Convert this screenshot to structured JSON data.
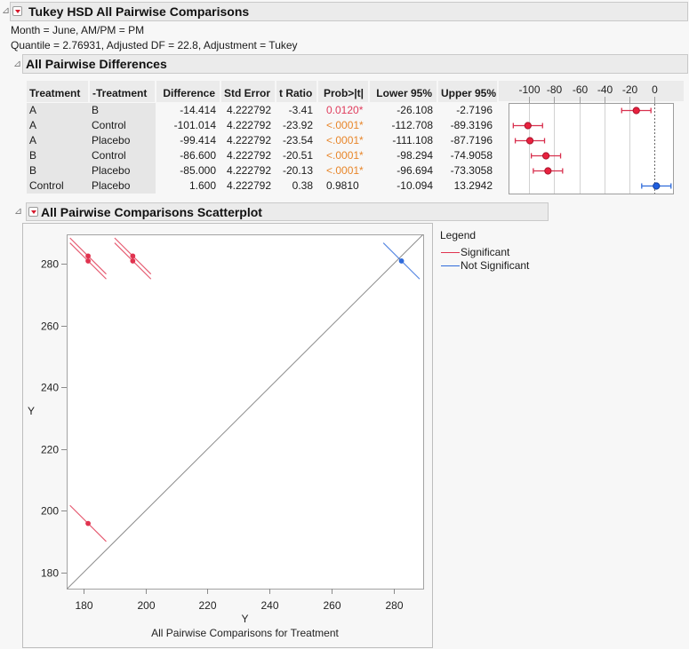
{
  "report": {
    "title": "Tukey HSD All Pairwise Comparisons",
    "info_lines": [
      "Month = June, AM/PM = PM",
      "Quantile = 2.76931, Adjusted DF = 22.8, Adjustment = Tukey"
    ]
  },
  "differences": {
    "title": "All Pairwise Differences",
    "columns": [
      "Treatment",
      "-Treatment",
      "Difference",
      "Std Error",
      "t Ratio",
      "Prob>|t|",
      "Lower 95%",
      "Upper 95%"
    ],
    "prob_colors": {
      "highly_significant": "#e8862a",
      "significant": "#e03c5c",
      "none": "#1a1a1a"
    },
    "rows": [
      {
        "treatment": "A",
        "minus_treatment": "B",
        "difference": "-14.414",
        "std_error": "4.222792",
        "t_ratio": "-3.41",
        "prob": "0.0120*",
        "prob_level": "significant",
        "lower": "-26.108",
        "upper": "-2.7196"
      },
      {
        "treatment": "A",
        "minus_treatment": "Control",
        "difference": "-101.014",
        "std_error": "4.222792",
        "t_ratio": "-23.92",
        "prob": "<.0001*",
        "prob_level": "highly_significant",
        "lower": "-112.708",
        "upper": "-89.3196"
      },
      {
        "treatment": "A",
        "minus_treatment": "Placebo",
        "difference": "-99.414",
        "std_error": "4.222792",
        "t_ratio": "-23.54",
        "prob": "<.0001*",
        "prob_level": "highly_significant",
        "lower": "-111.108",
        "upper": "-87.7196"
      },
      {
        "treatment": "B",
        "minus_treatment": "Control",
        "difference": "-86.600",
        "std_error": "4.222792",
        "t_ratio": "-20.51",
        "prob": "<.0001*",
        "prob_level": "highly_significant",
        "lower": "-98.294",
        "upper": "-74.9058"
      },
      {
        "treatment": "B",
        "minus_treatment": "Placebo",
        "difference": "-85.000",
        "std_error": "4.222792",
        "t_ratio": "-20.13",
        "prob": "<.0001*",
        "prob_level": "highly_significant",
        "lower": "-96.694",
        "upper": "-73.3058"
      },
      {
        "treatment": "Control",
        "minus_treatment": "Placebo",
        "difference": "1.600",
        "std_error": "4.222792",
        "t_ratio": "0.38",
        "prob": "0.9810",
        "prob_level": "none",
        "lower": "-10.094",
        "upper": "13.2942"
      }
    ]
  },
  "scatterplot": {
    "title": "All Pairwise Comparisons Scatterplot"
  },
  "chart_data": [
    {
      "type": "scatter",
      "title": "All Pairwise Differences (interval plot)",
      "x_ticks": [
        -100,
        -80,
        -60,
        -40,
        -20,
        0
      ],
      "xlim": [
        -116.5,
        14.9
      ],
      "reference_line": 0,
      "grid": true,
      "colors": {
        "significant": {
          "fill": "#e8213e",
          "stroke": "#a8142c",
          "bar": "#d8304e"
        },
        "not_significant": {
          "fill": "#1f5fe0",
          "stroke": "#143f9c",
          "bar": "#2f6bdb"
        }
      },
      "series": [
        {
          "name": "A - B",
          "estimate": -14.414,
          "lower": -26.108,
          "upper": -2.7196,
          "significant": true
        },
        {
          "name": "A - Control",
          "estimate": -101.014,
          "lower": -112.708,
          "upper": -89.3196,
          "significant": true
        },
        {
          "name": "A - Placebo",
          "estimate": -99.414,
          "lower": -111.108,
          "upper": -87.7196,
          "significant": true
        },
        {
          "name": "B - Control",
          "estimate": -86.6,
          "lower": -98.294,
          "upper": -74.9058,
          "significant": true
        },
        {
          "name": "B - Placebo",
          "estimate": -85.0,
          "lower": -96.694,
          "upper": -73.3058,
          "significant": true
        },
        {
          "name": "Control - Placebo",
          "estimate": 1.6,
          "lower": -10.094,
          "upper": 13.2942,
          "significant": false
        }
      ]
    },
    {
      "type": "scatter",
      "title": "All Pairwise Comparisons Scatterplot",
      "subtitle": "All Pairwise Comparisons for Treatment",
      "xlabel": "Y",
      "ylabel": "Y",
      "xlim": [
        174.6,
        289.5
      ],
      "ylim": [
        174.8,
        289.5
      ],
      "x_ticks": [
        180,
        200,
        220,
        240,
        260,
        280
      ],
      "y_ticks": [
        180,
        200,
        220,
        240,
        260,
        280
      ],
      "diagonal": "y = x",
      "grid": false,
      "legend": {
        "title": "Legend",
        "position": "right",
        "entries": [
          {
            "label": "Significant",
            "color": "#e0334f"
          },
          {
            "label": "Not Significant",
            "color": "#2f6bdb"
          }
        ]
      },
      "points": [
        {
          "pair": "A vs B",
          "x": 181.5,
          "y": 195.9,
          "ci_half_width": 11.694,
          "significant": true
        },
        {
          "pair": "A vs Control",
          "x": 181.5,
          "y": 282.5,
          "ci_half_width": 11.694,
          "significant": true
        },
        {
          "pair": "A vs Placebo",
          "x": 181.5,
          "y": 280.9,
          "ci_half_width": 11.694,
          "significant": true
        },
        {
          "pair": "B vs Control",
          "x": 195.9,
          "y": 282.5,
          "ci_half_width": 11.694,
          "significant": true
        },
        {
          "pair": "B vs Placebo",
          "x": 195.9,
          "y": 280.9,
          "ci_half_width": 11.694,
          "significant": true
        },
        {
          "pair": "Control vs Placebo",
          "x": 282.5,
          "y": 280.9,
          "ci_half_width": 11.694,
          "significant": false
        }
      ]
    }
  ]
}
